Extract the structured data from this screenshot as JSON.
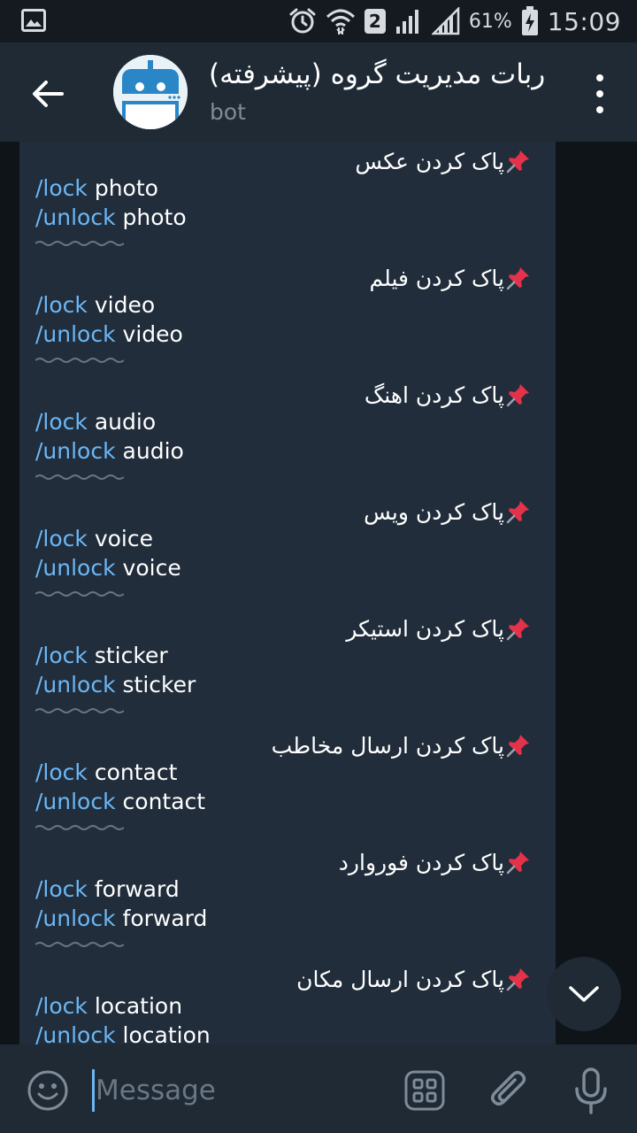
{
  "status_bar": {
    "sim_slot": "2",
    "battery": "61%",
    "time": "15:09"
  },
  "header": {
    "title": "ربات مدیریت گروه (پیشرفته)",
    "subtitle": "bot"
  },
  "message": {
    "sections": [
      {
        "heading": "پاک کردن عکس",
        "lock_cmd": "/lock",
        "unlock_cmd": "/unlock",
        "arg": "photo"
      },
      {
        "heading": "پاک کردن فیلم",
        "lock_cmd": "/lock",
        "unlock_cmd": "/unlock",
        "arg": "video"
      },
      {
        "heading": "پاک کردن اهنگ",
        "lock_cmd": "/lock",
        "unlock_cmd": "/unlock",
        "arg": "audio"
      },
      {
        "heading": "پاک کردن ویس",
        "lock_cmd": "/lock",
        "unlock_cmd": "/unlock",
        "arg": "voice"
      },
      {
        "heading": "پاک کردن استیکر",
        "lock_cmd": "/lock",
        "unlock_cmd": "/unlock",
        "arg": "sticker"
      },
      {
        "heading": "پاک کردن ارسال مخاطب",
        "lock_cmd": "/lock",
        "unlock_cmd": "/unlock",
        "arg": "contact"
      },
      {
        "heading": "پاک کردن فوروارد",
        "lock_cmd": "/lock",
        "unlock_cmd": "/unlock",
        "arg": "forward"
      },
      {
        "heading": "پاک کردن ارسال مکان",
        "lock_cmd": "/lock",
        "unlock_cmd": "/unlock",
        "arg": "location"
      }
    ]
  },
  "composer": {
    "placeholder": "Message"
  },
  "colors": {
    "header_bg": "#1f2a35",
    "bubble_bg": "#212d3b",
    "command_link": "#6cb7f5",
    "background": "#0f1419"
  }
}
